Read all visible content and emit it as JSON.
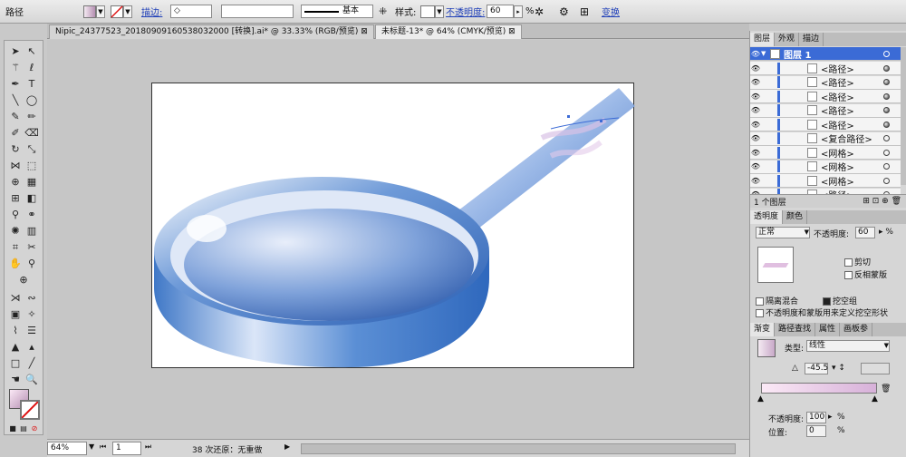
{
  "control_bar": {
    "object_label": "路径",
    "stroke_label": "描边:",
    "stroke_profile": "基本",
    "style_label": "样式:",
    "opacity_label": "不透明度:",
    "opacity_value": "60",
    "percent": "%",
    "transform_label": "变换"
  },
  "tabs": [
    {
      "label": "Nipic_24377523_20180909160538032000 [转换].ai* @ 33.33% (RGB/预览)"
    },
    {
      "label": "未标题-13* @ 64% (CMYK/预览)"
    }
  ],
  "status": {
    "zoom": "64%",
    "page": "1",
    "message": "38 次还原：无重做"
  },
  "layers_panel": {
    "tabs": [
      "图层",
      "外观",
      "描边"
    ],
    "layer_name": "图层 1",
    "rows": [
      {
        "name": "<路径>",
        "target": "filled"
      },
      {
        "name": "<路径>",
        "target": "filled"
      },
      {
        "name": "<路径>",
        "target": "filled"
      },
      {
        "name": "<路径>",
        "target": "filled"
      },
      {
        "name": "<路径>",
        "target": "filled"
      },
      {
        "name": "<复合路径>",
        "target": "empty"
      },
      {
        "name": "<网格>",
        "target": "empty"
      },
      {
        "name": "<网格>",
        "target": "empty"
      },
      {
        "name": "<网格>",
        "target": "empty"
      },
      {
        "name": "<路径>",
        "target": "empty"
      }
    ],
    "footer": "1 个图层"
  },
  "transparency_panel": {
    "tabs": [
      "透明度",
      "颜色"
    ],
    "blend_mode": "正常",
    "opacity_label": "不透明度:",
    "opacity_value": "60",
    "clip_label": "剪切",
    "invert_label": "反相蒙版",
    "isolate_label": "隔离混合",
    "knockout_label": "挖空组",
    "opacity_mask_label": "不透明度和蒙版用来定义挖空形状"
  },
  "gradient_panel": {
    "tabs": [
      "渐变",
      "路径查找",
      "属性",
      "画板参"
    ],
    "type_label": "类型:",
    "type_value": "线性",
    "angle_value": "-45.5",
    "opacity_label": "不透明度:",
    "opacity_value": "100",
    "location_label": "位置:",
    "location_value": "0",
    "percent": "%"
  },
  "colors": {
    "accent": "#1f3fb8",
    "pan_blue": "#4f86cc",
    "selection": "#3b6bd6"
  }
}
